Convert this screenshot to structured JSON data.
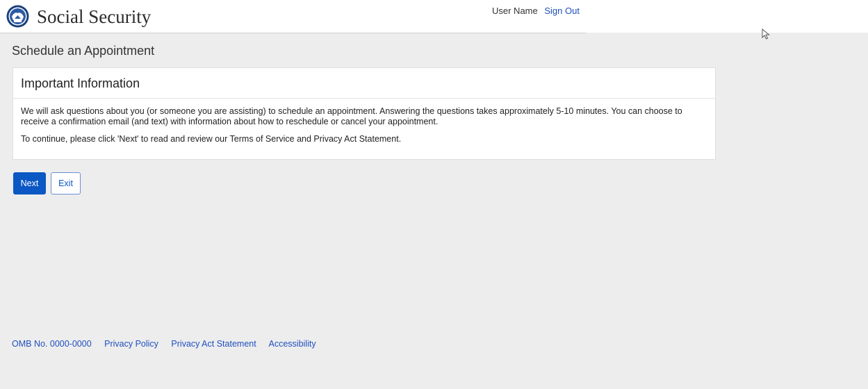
{
  "header": {
    "brand": "Social Security",
    "user_name": "User Name",
    "sign_out": "Sign Out",
    "logo_icon": "ssa-seal-icon"
  },
  "page": {
    "title": "Schedule an Appointment"
  },
  "card": {
    "title": "Important Information",
    "paragraph_1": "We will ask questions about you (or someone you are assisting) to schedule an appointment. Answering the questions takes approximately 5-10 minutes. You can choose to receive a confirmation email (and text) with information about how to reschedule or cancel your appointment.",
    "paragraph_2": "To continue, please click 'Next' to read and review our Terms of Service and Privacy Act Statement."
  },
  "buttons": {
    "next": "Next",
    "exit": "Exit"
  },
  "footer": {
    "omb": "OMB No. 0000-0000",
    "privacy_policy": "Privacy Policy",
    "privacy_act": "Privacy Act Statement",
    "accessibility": "Accessibility"
  },
  "colors": {
    "primary": "#0b57c4",
    "link": "#1f4fbf",
    "background": "#ededed"
  }
}
